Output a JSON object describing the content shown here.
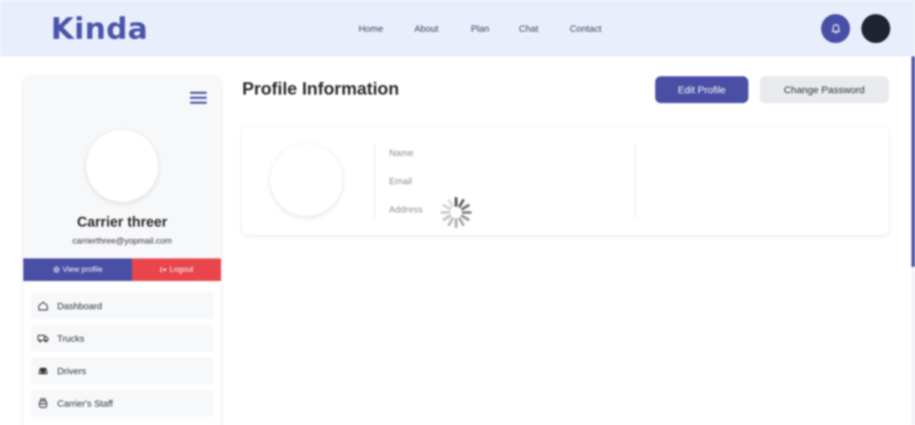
{
  "header": {
    "logo": "Kinda",
    "nav": [
      "Home",
      "About",
      "Plan",
      "Chat",
      "Contact"
    ],
    "bell_icon": "bell-icon"
  },
  "sidebar": {
    "name": "Carrier threer",
    "email": "carrierthree@yopmail.com",
    "view_profile": "View profile",
    "logout": "Logout",
    "items": [
      {
        "label": "Dashboard",
        "icon": "home-icon"
      },
      {
        "label": "Trucks",
        "icon": "truck-icon"
      },
      {
        "label": "Drivers",
        "icon": "car-icon"
      },
      {
        "label": "Carrier's Staff",
        "icon": "staff-icon"
      }
    ]
  },
  "main": {
    "title": "Profile Information",
    "edit_profile": "Edit Profile",
    "change_password": "Change Password",
    "fields": [
      "Name",
      "Email",
      "Address"
    ]
  },
  "colors": {
    "brand": "#4a4fa6",
    "danger": "#e8464a",
    "header_bg": "#e8eefc"
  }
}
